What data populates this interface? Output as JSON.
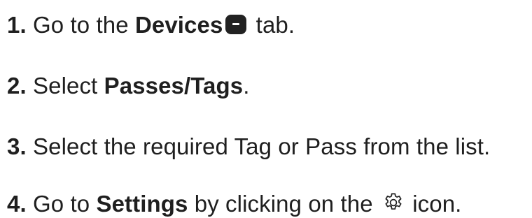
{
  "steps": [
    {
      "number": "1.",
      "prefix": " Go to the ",
      "highlight": "Devices",
      "icon": "devices-tab-icon",
      "suffix": " tab."
    },
    {
      "number": "2.",
      "prefix": " Select ",
      "highlight": "Passes/Tags",
      "suffix": "."
    },
    {
      "number": "3.",
      "prefix": " Select the required Tag or Pass from the list."
    },
    {
      "number": "4.",
      "prefix": " Go to ",
      "highlight": "Settings",
      "middle": " by clicking on the ",
      "icon": "gear-icon",
      "suffix": " icon."
    }
  ]
}
